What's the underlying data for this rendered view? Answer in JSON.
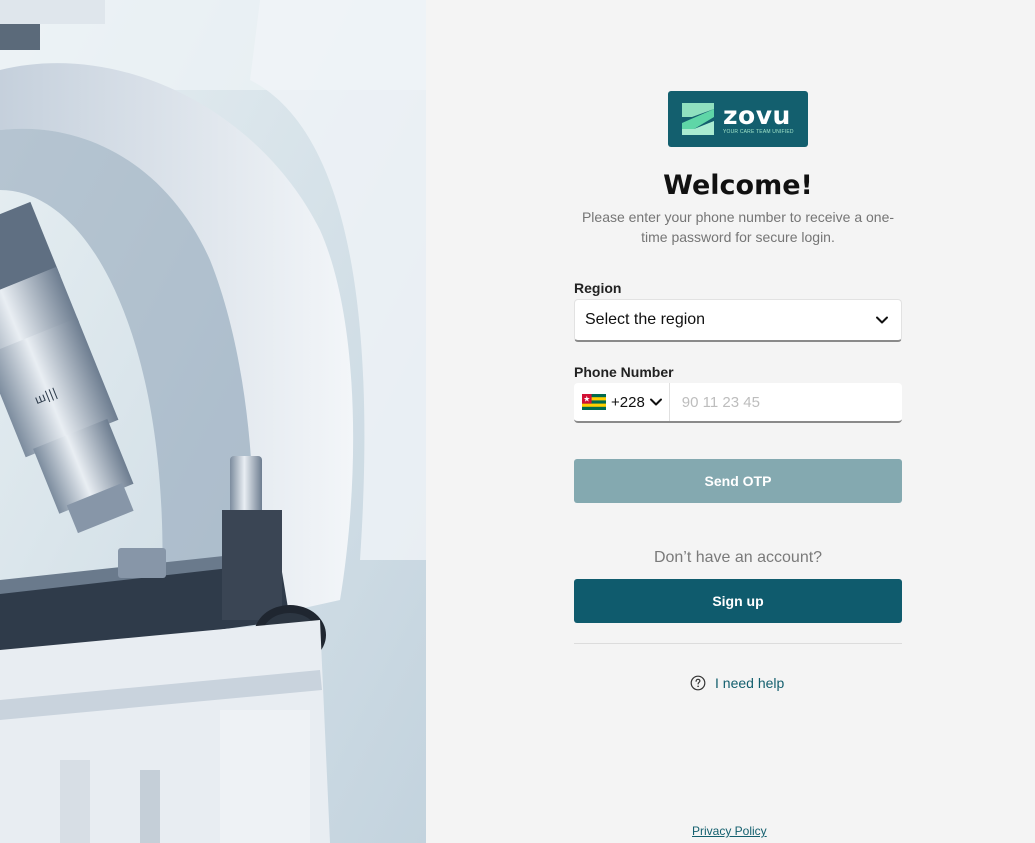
{
  "brand": {
    "name": "zovu",
    "tagline": "YOUR CARE TEAM UNIFIED",
    "colors": {
      "primary": "#0f5b6d",
      "logo_bg": "#135f6e",
      "accent": "#5fd6a7",
      "disabled_button": "#84a9b0"
    }
  },
  "hero": {
    "image": "microscope-photo"
  },
  "login": {
    "title": "Welcome!",
    "subtitle": "Please enter your phone number to receive a one-time password for secure login.",
    "region": {
      "label": "Region",
      "placeholder": "Select the region",
      "icon": "chevron-down-icon"
    },
    "phone": {
      "label": "Phone Number",
      "country_flag": "togo-flag",
      "country_code": "+228",
      "placeholder": "90 11 23 45",
      "value": ""
    },
    "send_otp_label": "Send OTP",
    "no_account_text": "Don’t have an account?",
    "signup_label": "Sign up",
    "help": {
      "label": "I need help",
      "icon": "question-circle-icon"
    },
    "privacy_label": "Privacy Policy"
  }
}
